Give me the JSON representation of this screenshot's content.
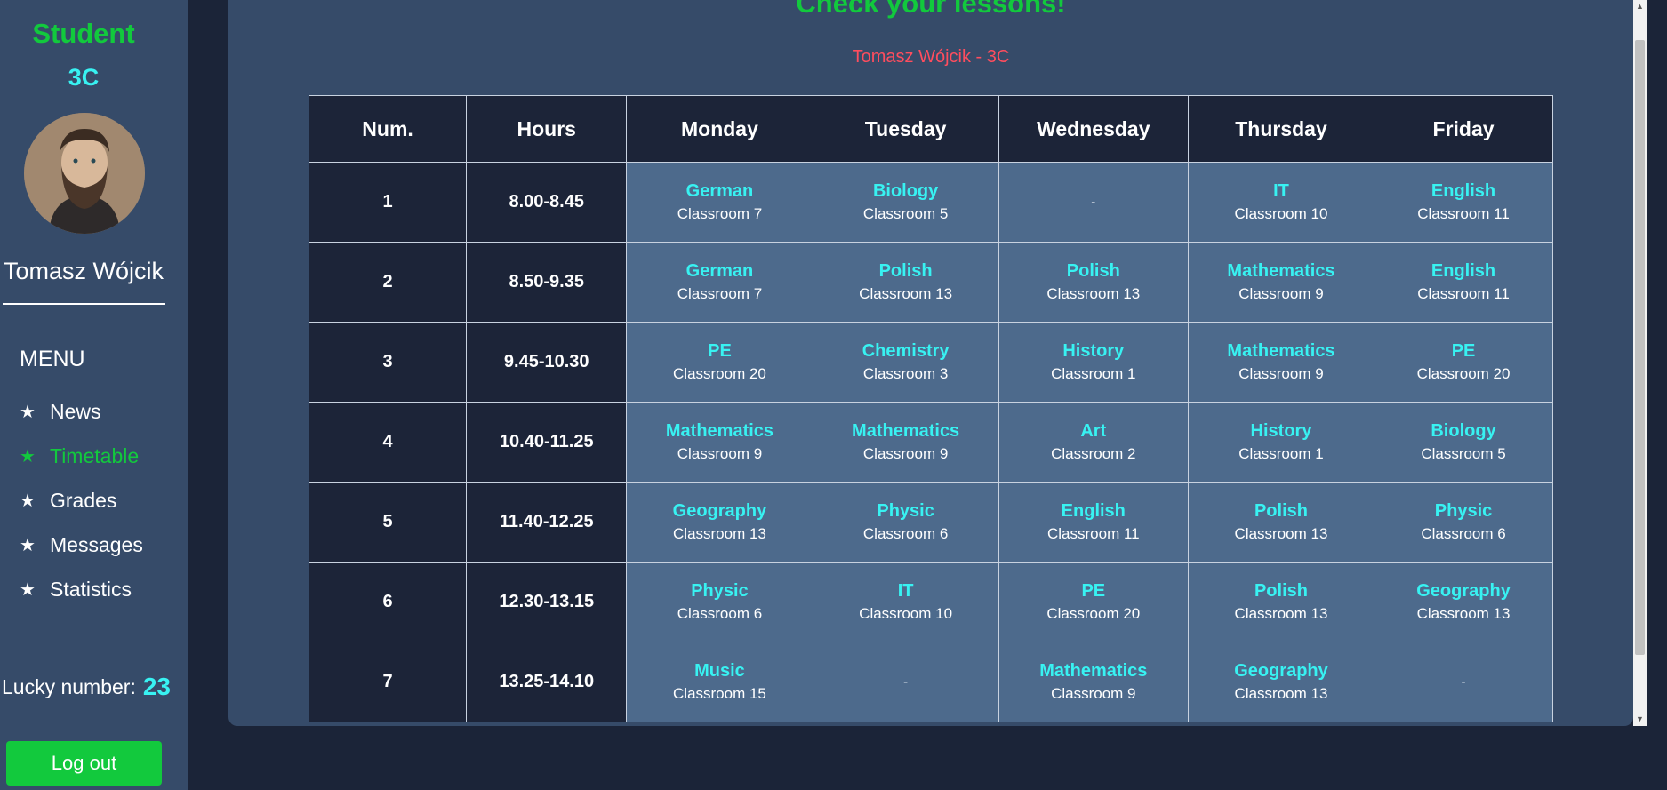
{
  "sidebar": {
    "role": "Student",
    "class_name": "3C",
    "user_name": "Tomasz Wójcik",
    "menu_title": "MENU",
    "menu_items": [
      {
        "label": "News",
        "icon": "star-icon"
      },
      {
        "label": "Timetable",
        "icon": "star-icon",
        "active": true
      },
      {
        "label": "Grades",
        "icon": "star-icon"
      },
      {
        "label": "Messages",
        "icon": "star-icon"
      },
      {
        "label": "Statistics",
        "icon": "star-icon"
      }
    ],
    "lucky_label": "Lucky number:",
    "lucky_number": "23",
    "logout_label": "Log out"
  },
  "main": {
    "title": "Check your lessons!",
    "subtitle": "Tomasz Wójcik - 3C",
    "headers": [
      "Num.",
      "Hours",
      "Monday",
      "Tuesday",
      "Wednesday",
      "Thursday",
      "Friday"
    ],
    "rows": [
      {
        "num": "1",
        "hours": "8.00-8.45",
        "lessons": [
          {
            "subject": "German",
            "room": "Classroom 7"
          },
          {
            "subject": "Biology",
            "room": "Classroom 5"
          },
          {
            "subject": "-",
            "room": ""
          },
          {
            "subject": "IT",
            "room": "Classroom 10"
          },
          {
            "subject": "English",
            "room": "Classroom 11"
          }
        ]
      },
      {
        "num": "2",
        "hours": "8.50-9.35",
        "lessons": [
          {
            "subject": "German",
            "room": "Classroom 7"
          },
          {
            "subject": "Polish",
            "room": "Classroom 13"
          },
          {
            "subject": "Polish",
            "room": "Classroom 13"
          },
          {
            "subject": "Mathematics",
            "room": "Classroom 9"
          },
          {
            "subject": "English",
            "room": "Classroom 11"
          }
        ]
      },
      {
        "num": "3",
        "hours": "9.45-10.30",
        "lessons": [
          {
            "subject": "PE",
            "room": "Classroom 20"
          },
          {
            "subject": "Chemistry",
            "room": "Classroom 3"
          },
          {
            "subject": "History",
            "room": "Classroom 1"
          },
          {
            "subject": "Mathematics",
            "room": "Classroom 9"
          },
          {
            "subject": "PE",
            "room": "Classroom 20"
          }
        ]
      },
      {
        "num": "4",
        "hours": "10.40-11.25",
        "lessons": [
          {
            "subject": "Mathematics",
            "room": "Classroom 9"
          },
          {
            "subject": "Mathematics",
            "room": "Classroom 9"
          },
          {
            "subject": "Art",
            "room": "Classroom 2"
          },
          {
            "subject": "History",
            "room": "Classroom 1"
          },
          {
            "subject": "Biology",
            "room": "Classroom 5"
          }
        ]
      },
      {
        "num": "5",
        "hours": "11.40-12.25",
        "lessons": [
          {
            "subject": "Geography",
            "room": "Classroom 13"
          },
          {
            "subject": "Physic",
            "room": "Classroom 6"
          },
          {
            "subject": "English",
            "room": "Classroom 11"
          },
          {
            "subject": "Polish",
            "room": "Classroom 13"
          },
          {
            "subject": "Physic",
            "room": "Classroom 6"
          }
        ]
      },
      {
        "num": "6",
        "hours": "12.30-13.15",
        "lessons": [
          {
            "subject": "Physic",
            "room": "Classroom 6"
          },
          {
            "subject": "IT",
            "room": "Classroom 10"
          },
          {
            "subject": "PE",
            "room": "Classroom 20"
          },
          {
            "subject": "Polish",
            "room": "Classroom 13"
          },
          {
            "subject": "Geography",
            "room": "Classroom 13"
          }
        ]
      },
      {
        "num": "7",
        "hours": "13.25-14.10",
        "lessons": [
          {
            "subject": "Music",
            "room": "Classroom 15"
          },
          {
            "subject": "-",
            "room": ""
          },
          {
            "subject": "Mathematics",
            "room": "Classroom 9"
          },
          {
            "subject": "Geography",
            "room": "Classroom 13"
          },
          {
            "subject": "-",
            "room": ""
          }
        ]
      }
    ]
  },
  "colors": {
    "accent_green": "#12c93d",
    "accent_cyan": "#38f2f2",
    "subtitle_red": "#ff4d5e",
    "background": "#1b2438",
    "panel": "#364b69"
  }
}
